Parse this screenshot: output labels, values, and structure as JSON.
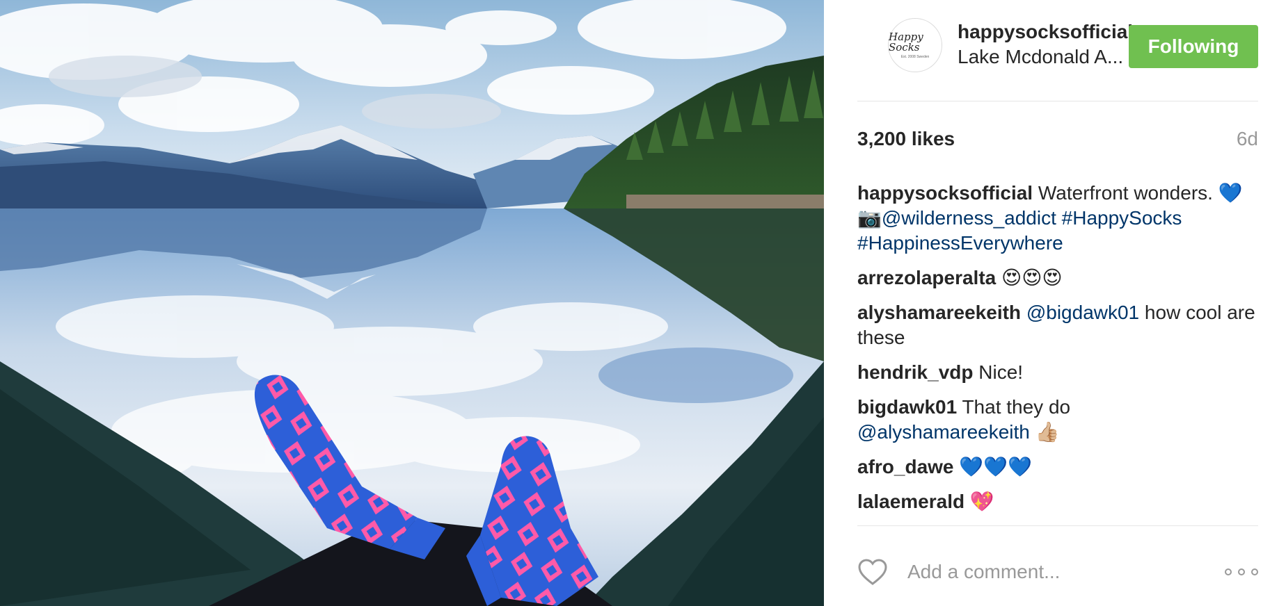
{
  "post": {
    "photo": {
      "description_icon": "photo-image",
      "sock_color": "#2d5fd8",
      "sock_pattern_color": "#ff5aa8"
    },
    "owner": {
      "username": "happysocksofficial",
      "location": "Lake Mcdonald A...",
      "avatar_logo_text": "Happy Socks",
      "avatar_logo_sub": "Est. 2008 Sweden"
    },
    "follow_label": "Following",
    "follow_color": "#70c050",
    "likes": "3,200 likes",
    "age": "6d",
    "caption": {
      "user": "happysocksofficial",
      "text": "Waterfront wonders.",
      "emoji": "💙",
      "camera_emoji": "📷",
      "mention": "@wilderness_addict",
      "tag1": "#HappySocks",
      "tag2": "#HappinessEverywhere"
    },
    "comments": [
      {
        "user": "arrezolaperalta",
        "text": "😍😍😍"
      },
      {
        "user": "alyshamareekeith",
        "mention": "@bigdawk01",
        "text": "how cool are these"
      },
      {
        "user": "hendrik_vdp",
        "text": "Nice!"
      },
      {
        "user": "bigdawk01",
        "text": "That they do",
        "mention": "@alyshamareekeith",
        "emoji": "👍🏼"
      },
      {
        "user": "afro_dawe",
        "text": "💙💙💙"
      },
      {
        "user": "lalaemerald",
        "text": "💖"
      }
    ],
    "comment_placeholder": "Add a comment...",
    "icons": {
      "like": "heart-outline-icon",
      "more": "more-options-icon"
    }
  }
}
